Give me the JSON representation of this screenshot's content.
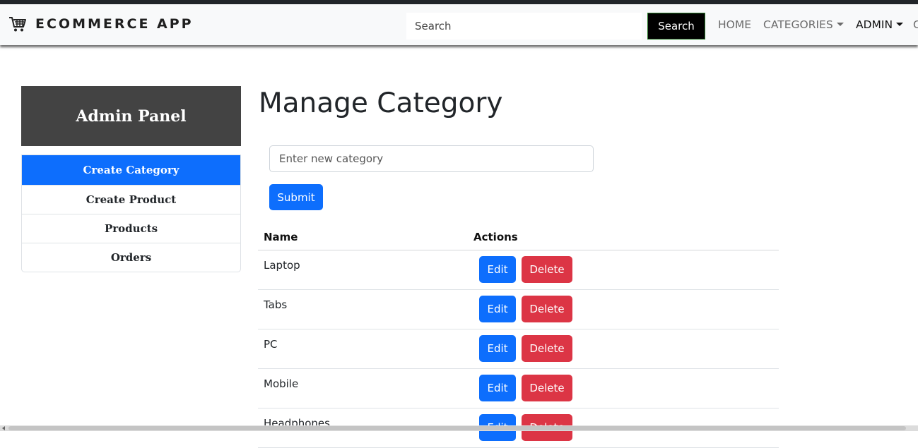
{
  "navbar": {
    "brand": "ECOMMERCE APP",
    "search_placeholder": "Search",
    "search_button": "Search",
    "links": [
      "HOME",
      "CATEGORIES",
      "ADMIN"
    ],
    "cut_link": "C"
  },
  "sidebar": {
    "title": "Admin Panel",
    "items": [
      "Create Category",
      "Create Product",
      "Products",
      "Orders"
    ],
    "active_index": 0
  },
  "main": {
    "title": "Manage Category",
    "category_input_placeholder": "Enter new category",
    "submit_label": "Submit",
    "table": {
      "headers": [
        "Name",
        "Actions"
      ],
      "edit_label": "Edit",
      "delete_label": "Delete",
      "rows": [
        "Laptop",
        "Tabs",
        "PC",
        "Mobile",
        "Headphones"
      ]
    }
  },
  "colors": {
    "primary": "#0d6efd",
    "danger": "#dc3545",
    "admin_header": "#434343",
    "navbar_bg": "#f8f9fa"
  },
  "icons": [
    "shopping-cart-icon",
    "caret-down-icon"
  ]
}
